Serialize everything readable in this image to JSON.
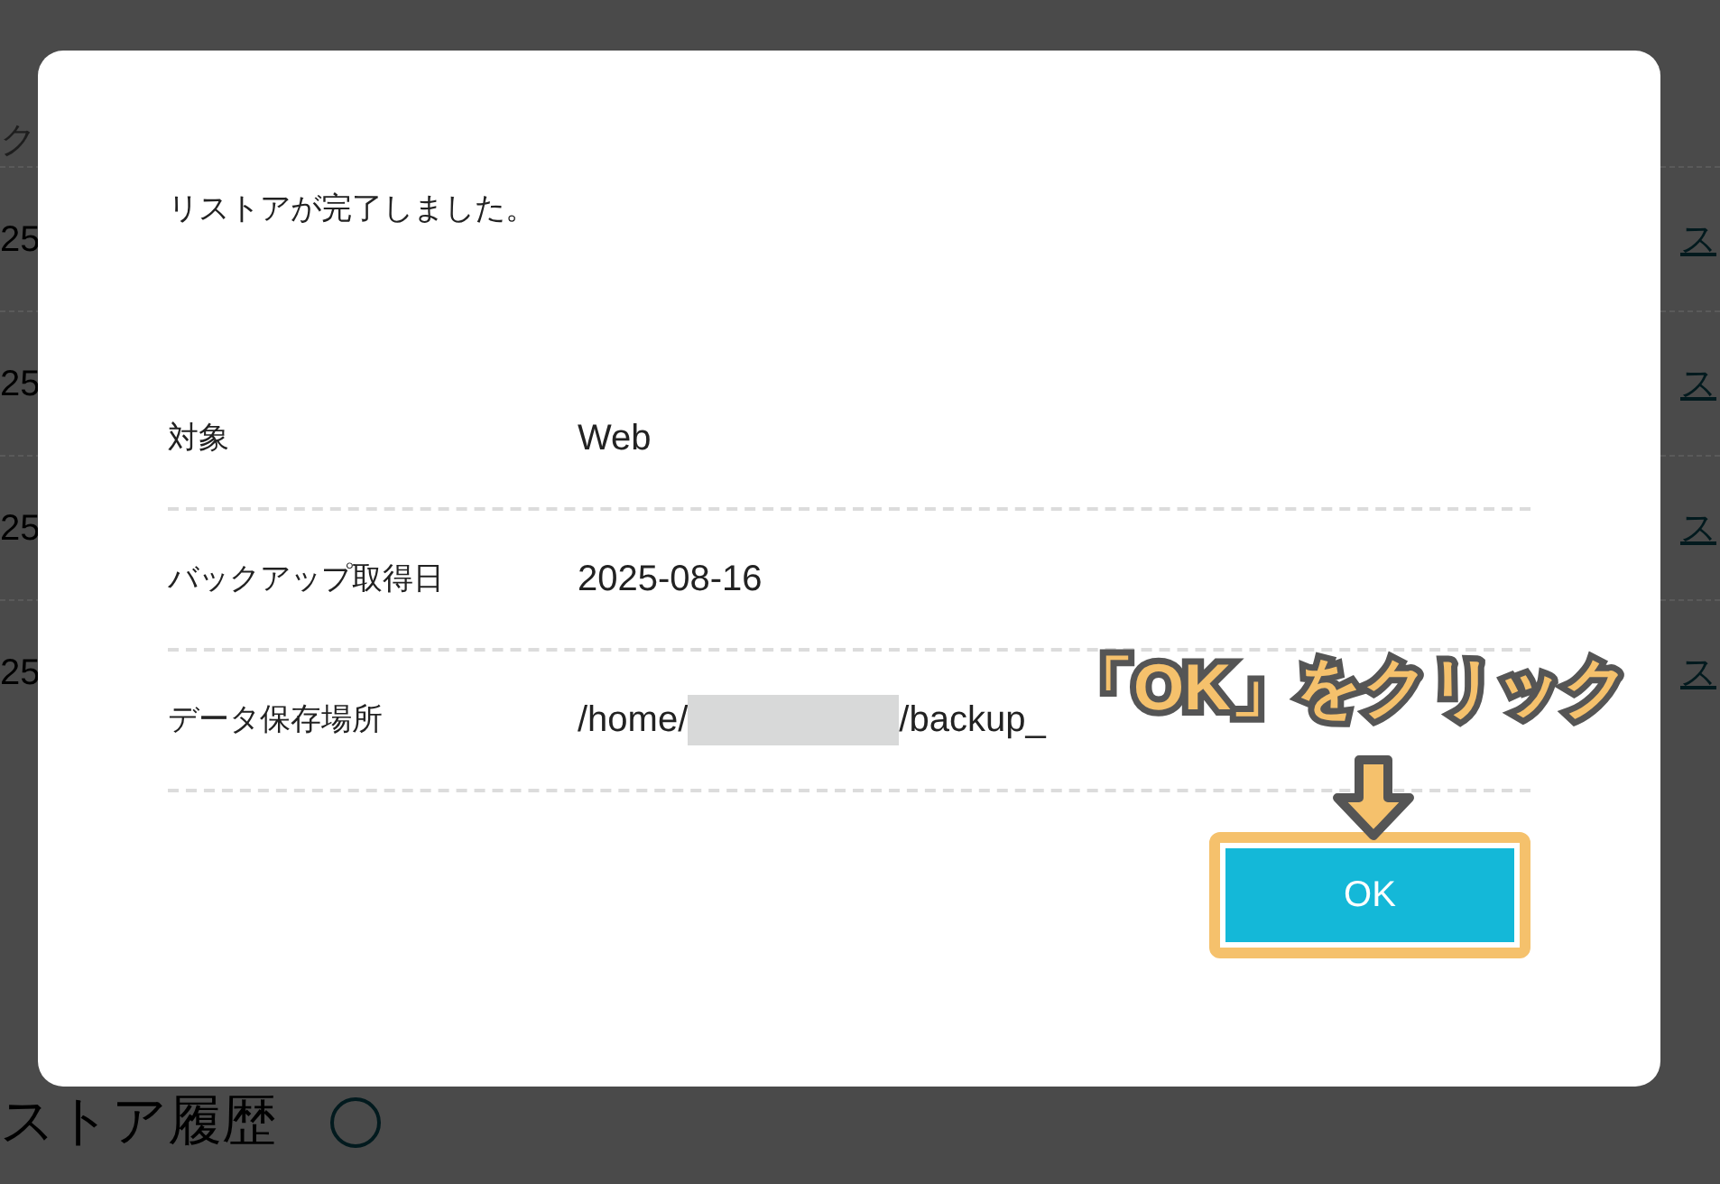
{
  "background": {
    "top_fragment": "ク",
    "rows": [
      {
        "date_fragment": "25",
        "link_fragment": "ス"
      },
      {
        "date_fragment": "25",
        "link_fragment": "ス"
      },
      {
        "date_fragment": "25",
        "link_fragment": "ス"
      },
      {
        "date_fragment": "25",
        "link_fragment": "ス"
      }
    ],
    "heading_fragment": "ストア履歴"
  },
  "dialog": {
    "message": "リストアが完了しました。",
    "details": [
      {
        "label": "対象",
        "value": "Web"
      },
      {
        "label": "バックアップ取得日",
        "value": "2025-08-16"
      },
      {
        "label": "データ保存場所",
        "value_prefix": "/home/",
        "value_suffix": "/backup_",
        "kind": "redacted"
      }
    ],
    "button": "OK"
  },
  "annotation": {
    "text": "「OK」をクリック"
  }
}
